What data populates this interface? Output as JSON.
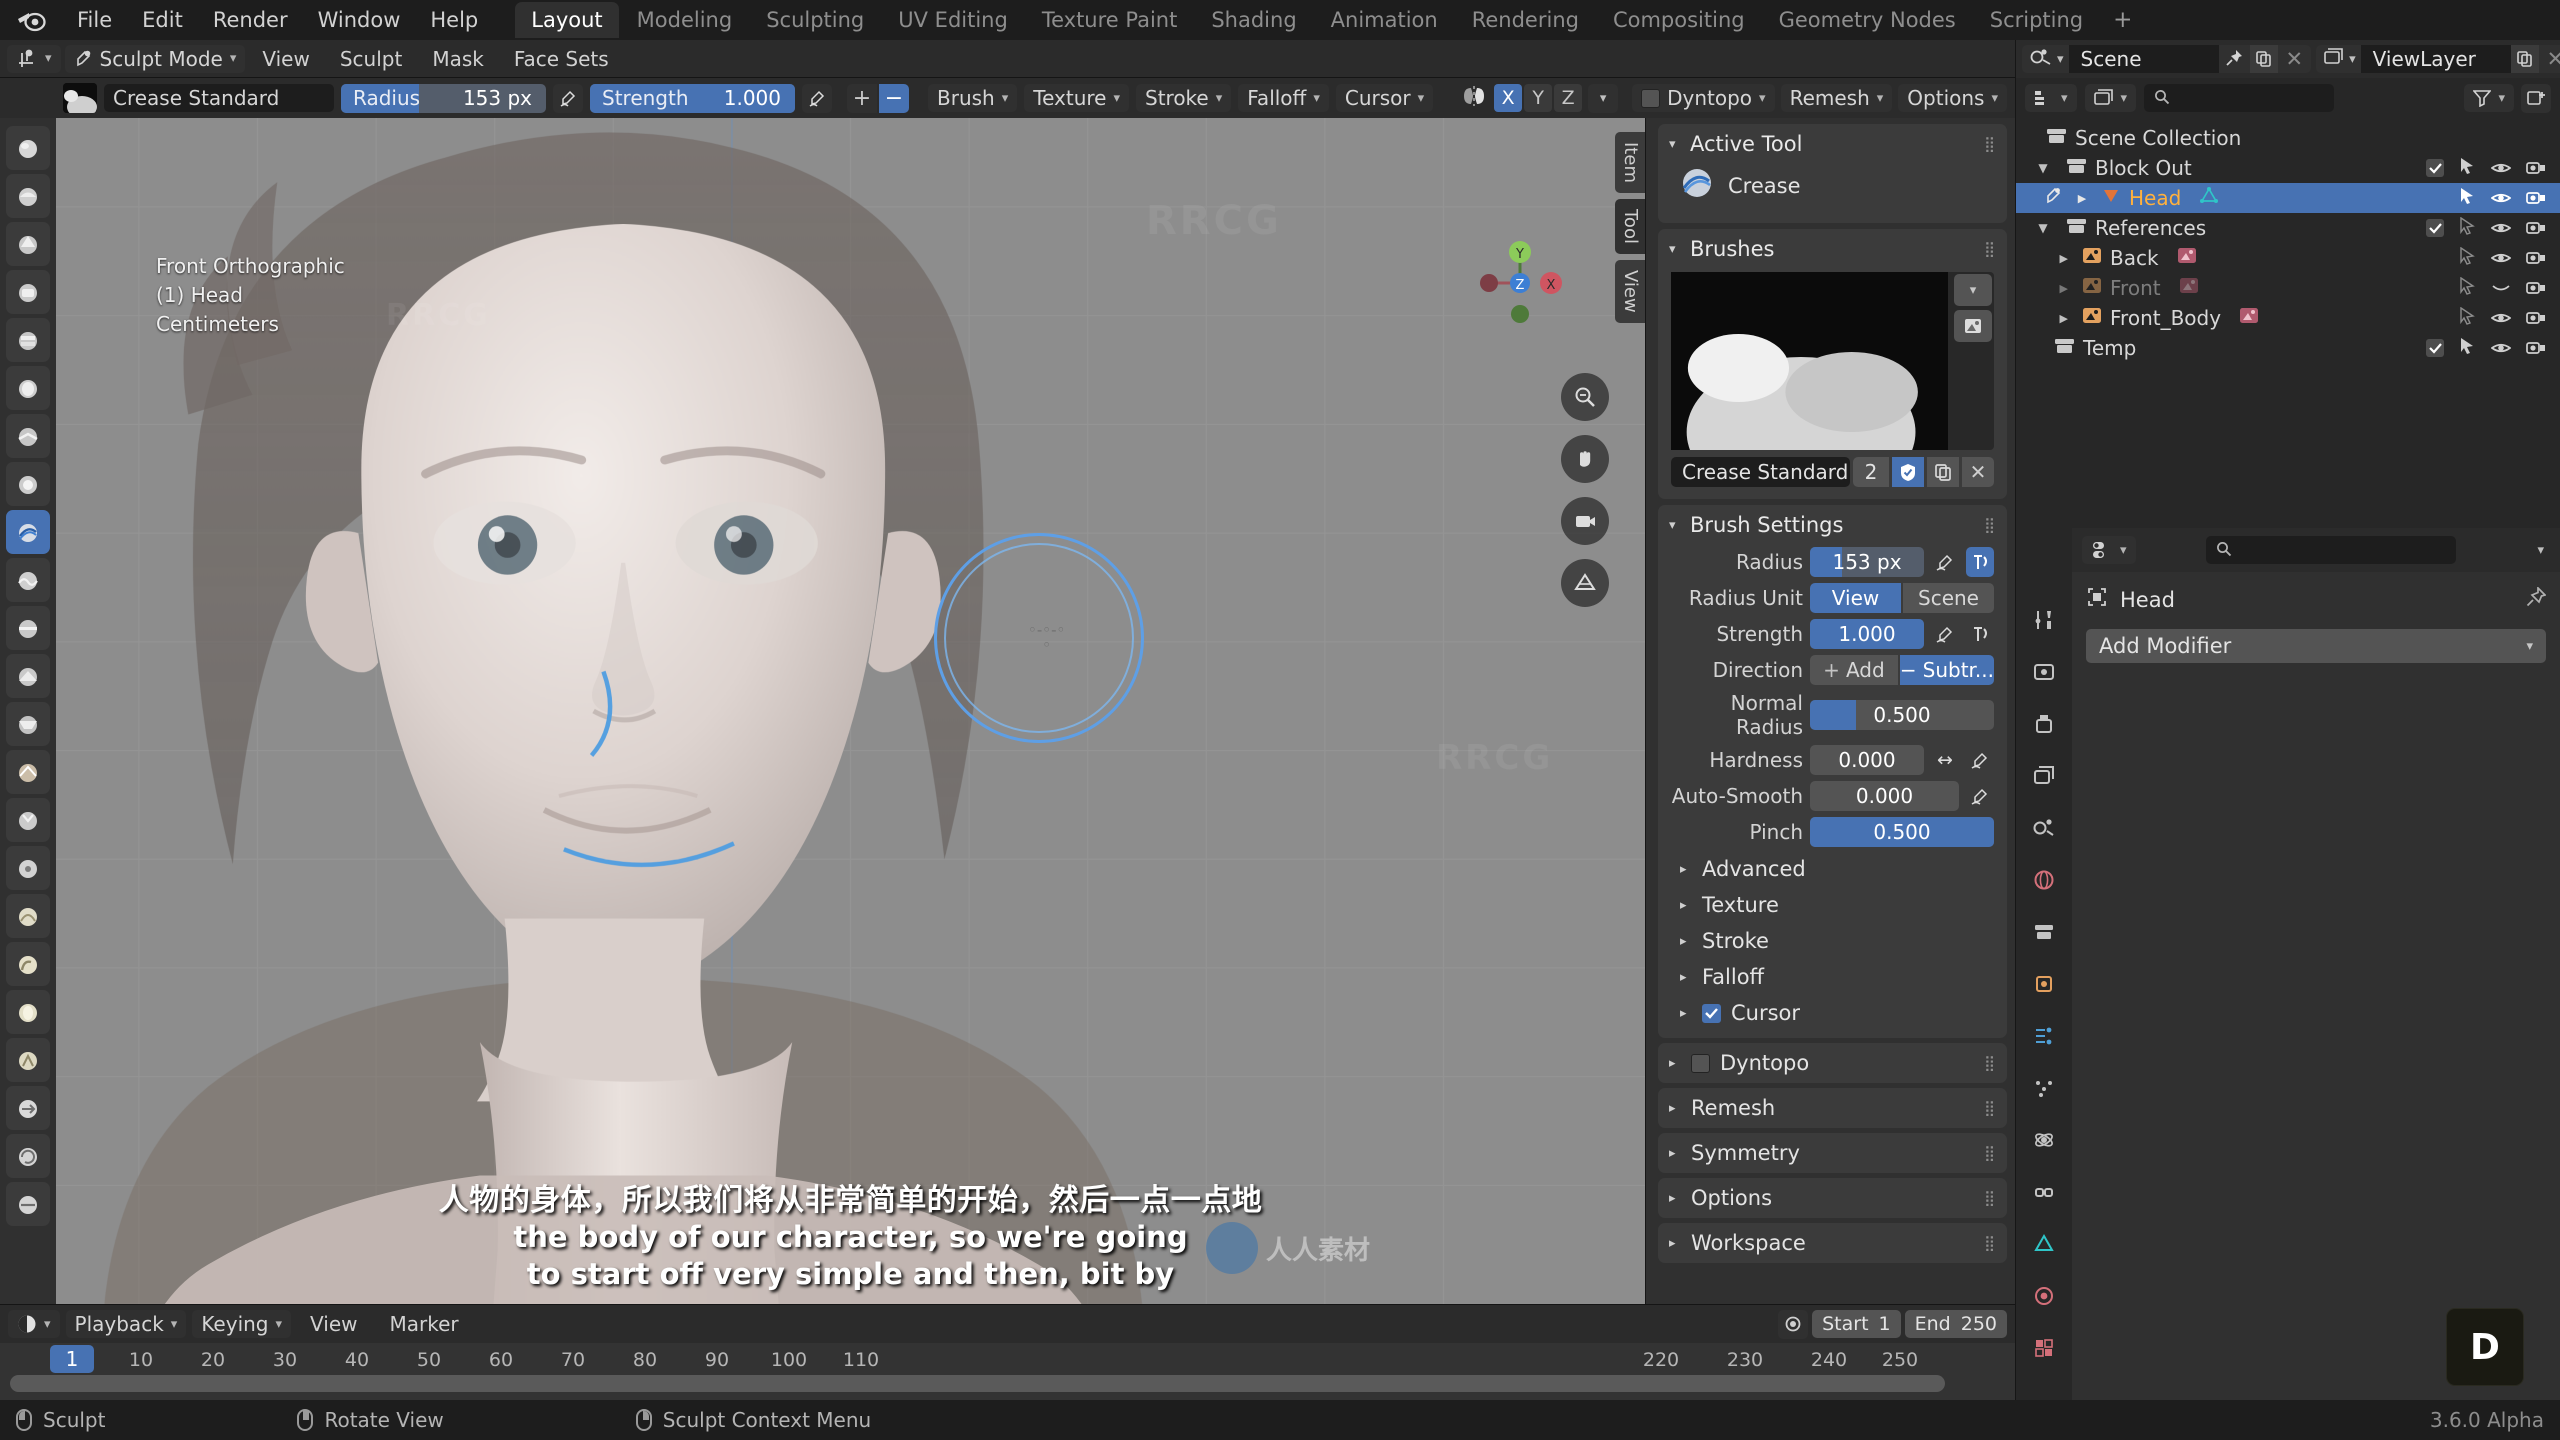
{
  "app": {
    "title": "Blender",
    "version": "3.6.0 Alpha"
  },
  "topbar": {
    "logo_icon": "blender-logo-icon",
    "menus": [
      "File",
      "Edit",
      "Render",
      "Window",
      "Help"
    ],
    "workspace_tabs": [
      {
        "label": "Layout",
        "active": true
      },
      {
        "label": "Modeling",
        "active": false
      },
      {
        "label": "Sculpting",
        "active": false
      },
      {
        "label": "UV Editing",
        "active": false
      },
      {
        "label": "Texture Paint",
        "active": false
      },
      {
        "label": "Shading",
        "active": false
      },
      {
        "label": "Animation",
        "active": false
      },
      {
        "label": "Rendering",
        "active": false
      },
      {
        "label": "Compositing",
        "active": false
      },
      {
        "label": "Geometry Nodes",
        "active": false
      },
      {
        "label": "Scripting",
        "active": false
      }
    ],
    "add_workspace": "+"
  },
  "viewport_header": {
    "editor_type_icon": "editor-type-icon",
    "mode": "Sculpt Mode",
    "menus": [
      "View",
      "Sculpt",
      "Mask",
      "Face Sets"
    ]
  },
  "tool_settings": {
    "brush_name": "Crease Standard",
    "radius_label": "Radius",
    "radius_value": "153 px",
    "radius_fill_pct": 38,
    "strength_label": "Strength",
    "strength_value": "1.000",
    "strength_fill_pct": 100,
    "pressure_icon": "pressure-pen-icon",
    "add_icon": "plus-icon",
    "subtract_icon": "minus-icon",
    "dropdowns": [
      "Brush",
      "Texture",
      "Stroke",
      "Falloff",
      "Cursor"
    ],
    "symmetry_icon": "symmetry-butterfly-icon",
    "axes": [
      {
        "label": "X",
        "on": true
      },
      {
        "label": "Y",
        "on": false
      },
      {
        "label": "Z",
        "on": false
      }
    ],
    "right_dropdowns": [
      "Dyntopo",
      "Remesh",
      "Options"
    ],
    "dyntopo_enabled": false
  },
  "toolshelf": {
    "tools": [
      {
        "name": "tool-blob",
        "active": false
      },
      {
        "name": "tool-draw",
        "active": false
      },
      {
        "name": "tool-draw-sharp",
        "active": false
      },
      {
        "name": "tool-clay",
        "active": false
      },
      {
        "name": "tool-clay-strips",
        "active": false
      },
      {
        "name": "tool-clay-thumb",
        "active": false
      },
      {
        "name": "tool-layer",
        "active": false
      },
      {
        "name": "tool-inflate",
        "active": false
      },
      {
        "name": "tool-crease",
        "active": true
      },
      {
        "name": "tool-smooth",
        "active": false
      },
      {
        "name": "tool-flatten",
        "active": false
      },
      {
        "name": "tool-fill",
        "active": false
      },
      {
        "name": "tool-scrape",
        "active": false
      },
      {
        "name": "tool-multiplane-scrape",
        "active": false
      },
      {
        "name": "tool-pinch",
        "active": false
      },
      {
        "name": "tool-grab",
        "active": false
      },
      {
        "name": "tool-elastic-deform",
        "active": false
      },
      {
        "name": "tool-snake-hook",
        "active": false
      },
      {
        "name": "tool-thumb",
        "active": false
      },
      {
        "name": "tool-pose",
        "active": false
      },
      {
        "name": "tool-nudge",
        "active": false
      },
      {
        "name": "tool-rotate",
        "active": false
      },
      {
        "name": "tool-slide-relax",
        "active": false
      }
    ]
  },
  "viewport": {
    "view_name": "Front Orthographic",
    "active_object": "(1) Head",
    "units": "Centimeters",
    "gizmo_axes": [
      "X",
      "Y",
      "Z"
    ],
    "side_icons": [
      "zoom-icon",
      "pan-hand-icon",
      "camera-icon",
      "grid-icon"
    ],
    "brush_cursor_radius_px": 100
  },
  "subtitles": {
    "chinese": "人物的身体，所以我们将从非常简单的开始，然后一点一点地",
    "english_line1": "the body of our character, so we're going",
    "english_line2": "to start off very simple and then, bit by"
  },
  "npanel": {
    "vertical_tabs": [
      "Item",
      "Tool",
      "View"
    ],
    "active_tool": {
      "header": "Active Tool",
      "tool_icon": "crease-brush-icon",
      "tool_name": "Crease"
    },
    "brushes": {
      "header": "Brushes",
      "preview_icon": "brush-preview-thumbnail",
      "dropdown_icon": "chevron-down-icon",
      "new_brush_icon": "new-image-icon",
      "brush_name": "Crease Standard",
      "users_count": "2",
      "fake_user_icon": "shield-icon",
      "fake_user_on": true,
      "duplicate_icon": "copy-icon",
      "unlink_icon": "x-icon"
    },
    "brush_settings": {
      "header": "Brush Settings",
      "rows": [
        {
          "label": "Radius",
          "value": "153 px",
          "type": "slider",
          "fill_pct": 28,
          "accent": false,
          "icons": [
            "pressure-pen-icon",
            "unified-radius-icon"
          ],
          "unified_on": true
        },
        {
          "label": "Radius Unit",
          "type": "segment",
          "options": [
            {
              "label": "View",
              "on": true
            },
            {
              "label": "Scene",
              "on": false
            }
          ]
        },
        {
          "label": "Strength",
          "value": "1.000",
          "type": "slider",
          "fill_pct": 100,
          "accent": true,
          "icons": [
            "pressure-pen-icon",
            "unified-strength-icon"
          ],
          "unified_on": false
        },
        {
          "label": "Direction",
          "type": "segment",
          "options": [
            {
              "label": "Add",
              "on": false,
              "icon": "plus-icon"
            },
            {
              "label": "Subtr...",
              "on": true,
              "icon": "minus-icon"
            }
          ]
        },
        {
          "label": "Normal Radius",
          "value": "0.500",
          "type": "slider",
          "fill_pct": 25,
          "accent": false
        },
        {
          "label": "Hardness",
          "value": "0.000",
          "type": "slider",
          "fill_pct": 0,
          "accent": false,
          "icons": [
            "arrows-horizontal-icon",
            "pressure-pen-icon"
          ]
        },
        {
          "label": "Auto-Smooth",
          "value": "0.000",
          "type": "slider",
          "fill_pct": 0,
          "accent": false,
          "icons": [
            "pressure-pen-icon"
          ]
        },
        {
          "label": "Pinch",
          "value": "0.500",
          "type": "slider",
          "fill_pct": 100,
          "accent": true
        }
      ],
      "subpanels": [
        {
          "label": "Advanced",
          "checkbox": null
        },
        {
          "label": "Texture",
          "checkbox": null
        },
        {
          "label": "Stroke",
          "checkbox": null
        },
        {
          "label": "Falloff",
          "checkbox": null
        },
        {
          "label": "Cursor",
          "checkbox": true
        }
      ]
    },
    "closed_panels": [
      {
        "label": "Dyntopo",
        "checkbox": false
      },
      {
        "label": "Remesh",
        "checkbox": null
      },
      {
        "label": "Symmetry",
        "checkbox": null
      },
      {
        "label": "Options",
        "checkbox": null
      },
      {
        "label": "Workspace",
        "checkbox": null
      }
    ]
  },
  "outliner": {
    "scene_icon": "scene-icon",
    "scene_name": "Scene",
    "pin_icon": "pin-icon",
    "new_scene_icon": "copy-icon",
    "remove_scene_icon": "x-icon",
    "viewlayer_icon": "viewlayer-icon",
    "viewlayer_name": "ViewLayer",
    "new_layer_icon": "copy-icon",
    "remove_layer_icon": "x-icon",
    "display_mode_icon": "outliner-display-mode-icon",
    "filter_icon": "filter-funnel-icon",
    "new_collection_icon": "new-collection-icon",
    "search_placeholder": "",
    "rows": [
      {
        "label": "Scene Collection",
        "indent": 0,
        "icon": "collection-icon",
        "expander": null,
        "selected": false,
        "dim": false,
        "checkbox": false,
        "cursor_arrow": false,
        "eye": false,
        "camera": false
      },
      {
        "label": "Block Out",
        "indent": 1,
        "icon": "collection-icon",
        "expander": "down",
        "selected": false,
        "dim": false,
        "checkbox": true,
        "cursor_arrow": true,
        "eye": true,
        "camera": true
      },
      {
        "label": "Head",
        "indent": 2,
        "icon": "mesh-object-icon",
        "expander": "right",
        "selected": true,
        "dim": false,
        "checkbox": false,
        "cursor_arrow": true,
        "eye": true,
        "camera": true,
        "data_icon": "mesh-data-icon",
        "mode_icon": "sculpt-mode-icon"
      },
      {
        "label": "References",
        "indent": 1,
        "icon": "collection-icon",
        "expander": "down",
        "selected": false,
        "dim": false,
        "checkbox": true,
        "cursor_arrow": true,
        "eye": true,
        "camera": true
      },
      {
        "label": "Back",
        "indent": 2,
        "icon": "image-object-icon",
        "expander": "right",
        "selected": false,
        "dim": false,
        "checkbox": false,
        "cursor_arrow": true,
        "eye": true,
        "camera": true,
        "data_icon": "image-data-icon"
      },
      {
        "label": "Front",
        "indent": 2,
        "icon": "image-object-icon",
        "expander": "right",
        "selected": false,
        "dim": true,
        "checkbox": false,
        "cursor_arrow": true,
        "eye": false,
        "camera": true,
        "data_icon": "image-data-icon"
      },
      {
        "label": "Front_Body",
        "indent": 2,
        "icon": "image-object-icon",
        "expander": "right",
        "selected": false,
        "dim": false,
        "checkbox": false,
        "cursor_arrow": true,
        "eye": true,
        "camera": true,
        "data_icon": "image-data-icon"
      },
      {
        "label": "Temp",
        "indent": 1,
        "icon": "collection-icon",
        "expander": null,
        "selected": false,
        "dim": false,
        "checkbox": true,
        "cursor_arrow": true,
        "eye": true,
        "camera": true
      }
    ]
  },
  "properties": {
    "editor_icon": "properties-editor-icon",
    "search_placeholder": "",
    "options_icon": "chevron-down-icon",
    "tabs": [
      "tool-tab-icon",
      "render-tab-icon",
      "output-tab-icon",
      "viewlayer-tab-icon",
      "scene-tab-icon",
      "world-tab-icon",
      "collection-tab-icon",
      "object-tab-icon",
      "modifier-tab-icon",
      "particles-tab-icon",
      "physics-tab-icon",
      "constraints-tab-icon",
      "data-tab-icon",
      "material-tab-icon",
      "texture-tab-icon"
    ],
    "breadcrumb_icon": "object-icon",
    "breadcrumb": "Head",
    "pin_icon": "pin-icon",
    "add_modifier": "Add Modifier"
  },
  "timeline": {
    "editor_icon": "timeline-editor-icon",
    "menus": [
      "Playback",
      "Keying",
      "View",
      "Marker"
    ],
    "current_frame": "1",
    "ticks": [
      "1",
      "10",
      "20",
      "30",
      "40",
      "50",
      "60",
      "70",
      "80",
      "90",
      "100",
      "110",
      "220",
      "230",
      "240",
      "250"
    ],
    "start_label": "Start",
    "start_value": "1",
    "end_label": "End",
    "end_value": "250",
    "autokey_icon": "record-icon"
  },
  "statusbar": {
    "items": [
      {
        "mouse": "left",
        "label": "Sculpt"
      },
      {
        "mouse": "middle",
        "label": "Rotate View"
      },
      {
        "mouse": "right",
        "label": "Sculpt Context Menu"
      }
    ],
    "version": "3.6.0 Alpha",
    "key_hint": "D"
  },
  "colors": {
    "accent_blue": "#4772b3",
    "panel_bg": "#303030",
    "header_bg": "#2b2b2b",
    "window_bg": "#1d1d1d",
    "selected_text_orange": "#ffb13d"
  }
}
